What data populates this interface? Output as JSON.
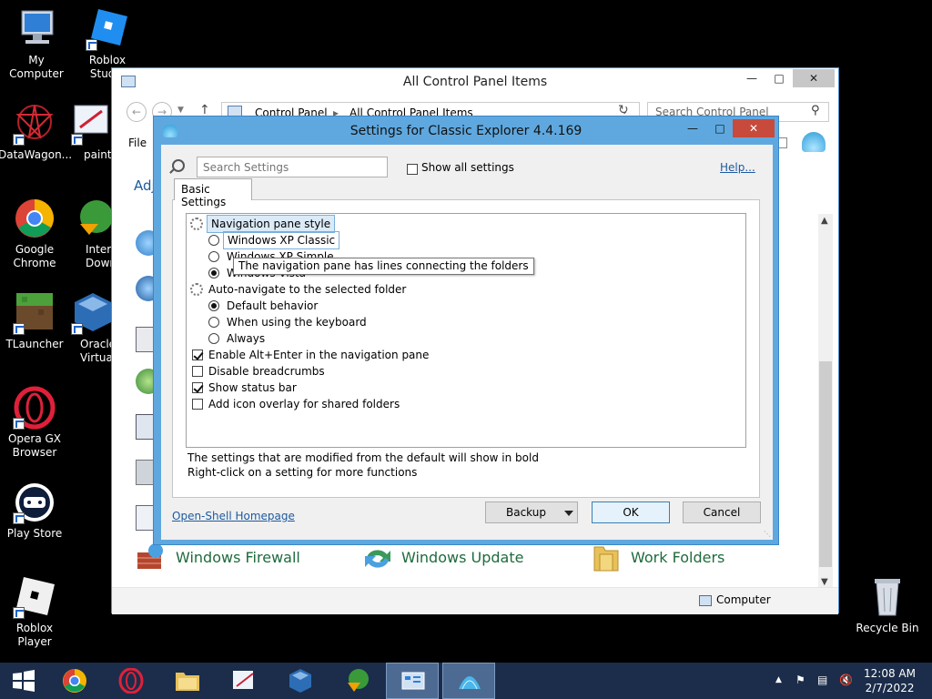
{
  "desktop": {
    "icons": [
      {
        "label": "My Computer"
      },
      {
        "label": "Roblox Studio"
      },
      {
        "label": "DataWagon..."
      },
      {
        "label": "paint..."
      },
      {
        "label": "Google Chrome"
      },
      {
        "label": "Inter Down"
      },
      {
        "label": "TLauncher"
      },
      {
        "label": "Oracle Virtua"
      },
      {
        "label": "Opera GX Browser"
      },
      {
        "label": "Play Store"
      },
      {
        "label": "Roblox Player"
      },
      {
        "label": "Recycle Bin"
      }
    ]
  },
  "control_panel": {
    "title": "All Control Panel Items",
    "breadcrumb": [
      "Control Panel",
      "All Control Panel Items"
    ],
    "search_placeholder": "Search Control Panel",
    "menu_file": "File",
    "heading_partial": "Adj",
    "items": [
      {
        "label": "Windows Firewall"
      },
      {
        "label": "Windows Update"
      },
      {
        "label": "Work Folders"
      }
    ],
    "status": "Computer"
  },
  "dialog": {
    "title": "Settings for Classic Explorer 4.4.169",
    "search_placeholder": "Search Settings",
    "show_all": "Show all settings",
    "help": "Help...",
    "tab": "Basic Settings",
    "settings": {
      "nav_style": "Navigation pane style",
      "xp_classic": "Windows XP Classic",
      "xp_simple": "Windows XP Simple",
      "vista": "Windows Vista",
      "auto_nav": "Auto-navigate to the selected folder",
      "default": "Default behavior",
      "keyboard": "When using the keyboard",
      "always": "Always",
      "alt_enter": "Enable Alt+Enter in the navigation pane",
      "breadcrumbs": "Disable breadcrumbs",
      "status_bar": "Show status bar",
      "overlay": "Add icon overlay for shared folders"
    },
    "tooltip": "The navigation pane has lines connecting the folders",
    "note1": "The settings that are modified from the default will show in bold",
    "note2": "Right-click on a setting for more functions",
    "homepage": "Open-Shell Homepage",
    "backup": "Backup",
    "ok": "OK",
    "cancel": "Cancel"
  },
  "taskbar": {
    "time": "12:08 AM",
    "date": "2/7/2022"
  }
}
